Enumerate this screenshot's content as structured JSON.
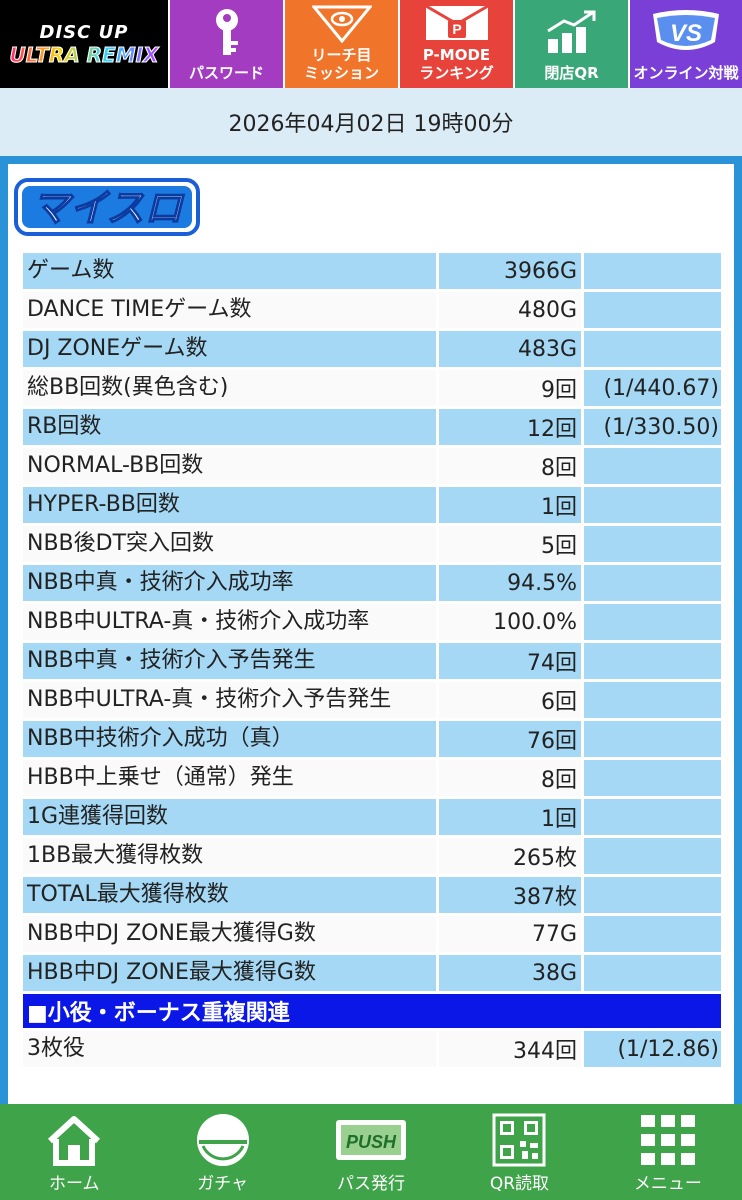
{
  "logo": {
    "line1": "DISC UP",
    "line2": "ULTRA REMIX"
  },
  "nav": [
    {
      "label": "パスワード",
      "icon": "key-icon"
    },
    {
      "label": "リーチ目\nミッション",
      "icon": "mission-badge-icon"
    },
    {
      "label": "P-MODE\nランキング",
      "icon": "pmode-icon"
    },
    {
      "label": "閉店QR",
      "icon": "chart-up-icon"
    },
    {
      "label": "オンライン対戦",
      "icon": "vs-shield-icon"
    }
  ],
  "datetime": "2026年04月02日 19時00分",
  "section_logo": "マイスロ",
  "stats": [
    {
      "label": "ゲーム数",
      "value": "3966G",
      "ratio": ""
    },
    {
      "label": "DANCE TIMEゲーム数",
      "value": "480G",
      "ratio": ""
    },
    {
      "label": "DJ ZONEゲーム数",
      "value": "483G",
      "ratio": ""
    },
    {
      "label": "総BB回数(異色含む)",
      "value": "9回",
      "ratio": "(1/440.67)"
    },
    {
      "label": "RB回数",
      "value": "12回",
      "ratio": "(1/330.50)"
    },
    {
      "label": "NORMAL-BB回数",
      "value": "8回",
      "ratio": ""
    },
    {
      "label": "HYPER-BB回数",
      "value": "1回",
      "ratio": ""
    },
    {
      "label": "NBB後DT突入回数",
      "value": "5回",
      "ratio": ""
    },
    {
      "label": "NBB中真・技術介入成功率",
      "value": "94.5%",
      "ratio": ""
    },
    {
      "label": "NBB中ULTRA-真・技術介入成功率",
      "value": "100.0%",
      "ratio": ""
    },
    {
      "label": "NBB中真・技術介入予告発生",
      "value": "74回",
      "ratio": ""
    },
    {
      "label": "NBB中ULTRA-真・技術介入予告発生",
      "value": "6回",
      "ratio": ""
    },
    {
      "label": "NBB中技術介入成功（真）",
      "value": "76回",
      "ratio": ""
    },
    {
      "label": "HBB中上乗せ（通常）発生",
      "value": "8回",
      "ratio": ""
    },
    {
      "label": "1G連獲得回数",
      "value": "1回",
      "ratio": ""
    },
    {
      "label": "1BB最大獲得枚数",
      "value": "265枚",
      "ratio": ""
    },
    {
      "label": "TOTAL最大獲得枚数",
      "value": "387枚",
      "ratio": ""
    },
    {
      "label": "NBB中DJ ZONE最大獲得G数",
      "value": "77G",
      "ratio": ""
    },
    {
      "label": "HBB中DJ ZONE最大獲得G数",
      "value": "38G",
      "ratio": ""
    }
  ],
  "section2_title": "■小役・ボーナス重複関連",
  "section2": [
    {
      "label": "3枚役",
      "value": "344回",
      "ratio": "(1/12.86)"
    }
  ],
  "bottom_nav": [
    {
      "label": "ホーム",
      "icon": "home-icon"
    },
    {
      "label": "ガチャ",
      "icon": "gacha-icon"
    },
    {
      "label": "パス発行",
      "icon": "push-icon",
      "icon_text": "PUSH"
    },
    {
      "label": "QR読取",
      "icon": "qr-code-icon"
    },
    {
      "label": "メニュー",
      "icon": "menu-grid-icon"
    }
  ],
  "colors": {
    "row_blue": "#a4d8f5",
    "section_header": "#0a17e6",
    "frame_blue": "#2a92d6",
    "bottom_green": "#3fa34a"
  }
}
